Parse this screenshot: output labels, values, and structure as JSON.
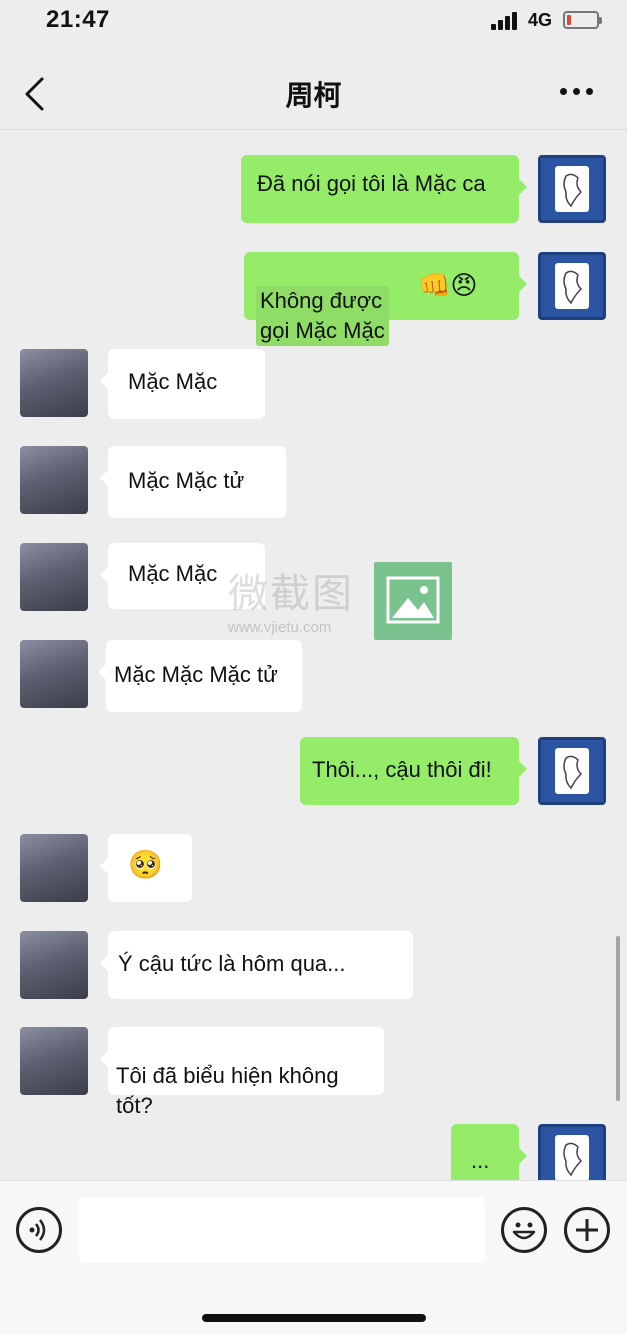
{
  "status_bar": {
    "time": "21:47",
    "network": "4G"
  },
  "header": {
    "title": "周柯"
  },
  "messages": [
    {
      "side": "right",
      "text": "Đã nói gọi tôi là Mặc ca"
    },
    {
      "side": "right",
      "text": "Không được\ngọi Mặc Mặc",
      "emoji": "👊😠"
    },
    {
      "side": "left",
      "text": "Mặc Mặc"
    },
    {
      "side": "left",
      "text": "Mặc Mặc tử"
    },
    {
      "side": "left",
      "text": "Mặc Mặc"
    },
    {
      "side": "left",
      "text": "Mặc Mặc Mặc tử"
    },
    {
      "side": "right",
      "text": "Thôi..., cậu thôi đi!"
    },
    {
      "side": "left",
      "text": "🥺"
    },
    {
      "side": "left",
      "text": "Ý cậu tức là hôm qua..."
    },
    {
      "side": "left",
      "text": "Tôi đã biểu hiện không\ntốt?"
    },
    {
      "side": "right",
      "text": "..."
    }
  ],
  "watermark": {
    "text": "微截图",
    "url": "www.vjietu.com"
  },
  "input_bar": {
    "placeholder": ""
  },
  "icons": {
    "back": "chevron-left-icon",
    "more": "more-dots-icon",
    "voice": "voice-icon",
    "emoji": "emoji-icon",
    "add": "plus-icon"
  }
}
